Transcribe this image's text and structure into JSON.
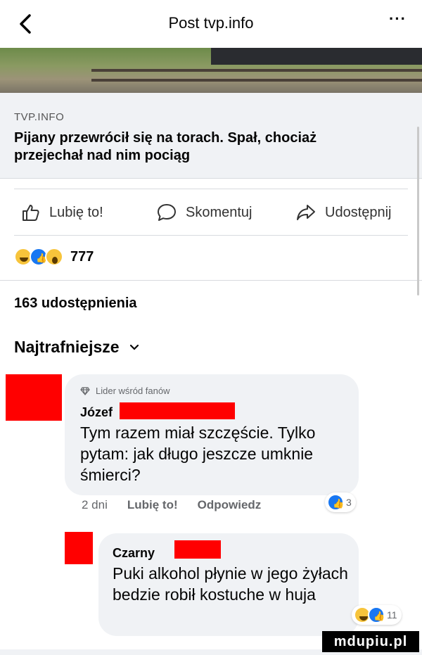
{
  "header": {
    "title": "Post tvp.info",
    "more": "···"
  },
  "link": {
    "domain": "TVP.INFO",
    "headline": "Pijany przewrócił się na torach. Spał, chociaż przejechał nad nim pociąg"
  },
  "actions": {
    "like": "Lubię to!",
    "comment": "Skomentuj",
    "share": "Udostępnij"
  },
  "reactions": {
    "icons": [
      "haha-icon",
      "like-icon",
      "wow-icon"
    ],
    "count": "777"
  },
  "shares": "163 udostępnienia",
  "sort": "Najtrafniejsze",
  "comments": [
    {
      "badge": "Lider wśród fanów",
      "author": "Józef",
      "text": "Tym razem miał szczęście. Tylko pytam: jak długo jeszcze umknie śmierci?",
      "time": "2 dni",
      "like": "Lubię to!",
      "reply": "Odpowiedz",
      "reaction_count": "3"
    },
    {
      "author": "Czarny",
      "text": "Puki alkohol płynie w jego żyłach bedzie robił kostuche w huja",
      "reaction_count": "11"
    }
  ],
  "watermark": "mdupiu.pl",
  "colors": {
    "brand_blue": "#1877f2",
    "redaction": "#ff0000",
    "bubble": "#f0f2f5"
  }
}
